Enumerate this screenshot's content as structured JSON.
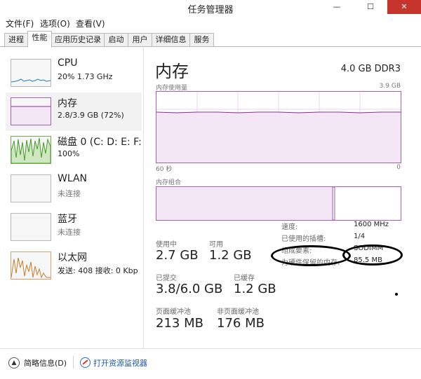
{
  "window": {
    "title": "任务管理器",
    "controls": {
      "minimize": "—",
      "maximize": "☐",
      "close": "✕"
    }
  },
  "menu": [
    "文件(F)",
    "选项(O)",
    "查看(V)"
  ],
  "tabs": [
    "进程",
    "性能",
    "应用历史记录",
    "启动",
    "用户",
    "详细信息",
    "服务"
  ],
  "active_tab": "性能",
  "sidebar": {
    "items": [
      {
        "name": "CPU",
        "sub": "20%  1.73 GHz"
      },
      {
        "name": "内存",
        "sub": "2.8/3.9 GB (72%)"
      },
      {
        "name": "磁盘 0 (C: D: E: F:",
        "sub": "100%"
      },
      {
        "name": "WLAN",
        "sub": "未连接"
      },
      {
        "name": "蓝牙",
        "sub": "未连接"
      },
      {
        "name": "以太网",
        "sub": "发送: 408  接收: 0 Kbp"
      }
    ]
  },
  "main": {
    "title": "内存",
    "spec": "4.0 GB DDR3",
    "usage_label": "内存使用量",
    "usage_max": "3.9 GB",
    "time_left": "60 秒",
    "time_right": "0",
    "usage_level": 0.71,
    "composition_label": "内存组合",
    "composition_in_use": 0.72,
    "composition_standby_edge": 0.73,
    "metrics": [
      {
        "label": "使用中",
        "value": "2.7 GB"
      },
      {
        "label": "可用",
        "value": "1.2 GB"
      },
      {
        "label": "已提交",
        "value": "3.8/6.0 GB"
      },
      {
        "label": "已缓存",
        "value": "1.2 GB"
      },
      {
        "label": "页面缓冲池",
        "value": "213 MB"
      },
      {
        "label": "非页面缓冲池",
        "value": "176 MB"
      }
    ],
    "details": [
      {
        "label": "速度:",
        "value": "1600 MHz"
      },
      {
        "label": "已使用的插槽:",
        "value": "1/4"
      },
      {
        "label": "组成要素:",
        "value": "SODIMM"
      },
      {
        "label": "为硬件保留的内存:",
        "value": "85.5 MB"
      }
    ]
  },
  "footer": {
    "summary": "简略信息(D)",
    "monitor": "打开资源监视器"
  },
  "colors": {
    "memory": "#8a2f9a",
    "cpu": "#1b7fbf",
    "disk": "#4a9a2a",
    "ethernet": "#c77d2a"
  }
}
